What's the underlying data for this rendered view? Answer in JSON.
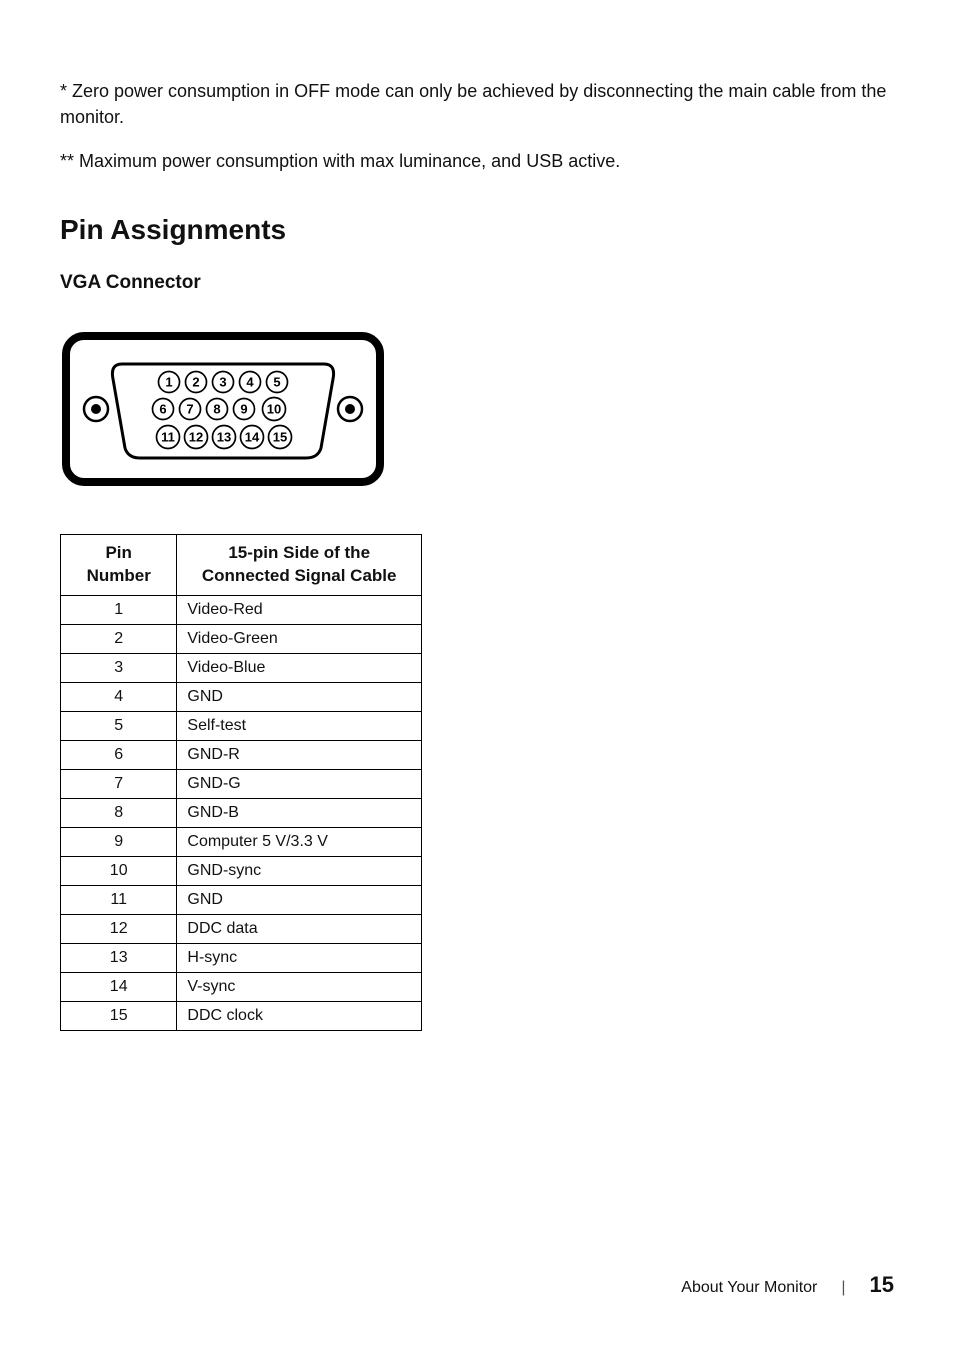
{
  "notes": {
    "note1": "* Zero power consumption in OFF mode can only be achieved by disconnecting the main cable from the monitor.",
    "note2": "** Maximum power consumption with max luminance, and USB active."
  },
  "section_title": "Pin Assignments",
  "sub_title": "VGA Connector",
  "connector_pins": [
    "1",
    "2",
    "3",
    "4",
    "5",
    "6",
    "7",
    "8",
    "9",
    "10",
    "11",
    "12",
    "13",
    "14",
    "15"
  ],
  "table": {
    "header_col1_line1": "Pin",
    "header_col1_line2": "Number",
    "header_col2_line1": "15-pin Side of the",
    "header_col2_line2": "Connected Signal Cable",
    "rows": [
      {
        "pin": "1",
        "signal": "Video-Red"
      },
      {
        "pin": "2",
        "signal": "Video-Green"
      },
      {
        "pin": "3",
        "signal": "Video-Blue"
      },
      {
        "pin": "4",
        "signal": "GND"
      },
      {
        "pin": "5",
        "signal": "Self-test"
      },
      {
        "pin": "6",
        "signal": "GND-R"
      },
      {
        "pin": "7",
        "signal": "GND-G"
      },
      {
        "pin": "8",
        "signal": "GND-B"
      },
      {
        "pin": "9",
        "signal": "Computer 5 V/3.3 V"
      },
      {
        "pin": "10",
        "signal": "GND-sync"
      },
      {
        "pin": "11",
        "signal": "GND"
      },
      {
        "pin": "12",
        "signal": "DDC data"
      },
      {
        "pin": "13",
        "signal": "H-sync"
      },
      {
        "pin": "14",
        "signal": "V-sync"
      },
      {
        "pin": "15",
        "signal": "DDC clock"
      }
    ]
  },
  "footer": {
    "text": "About Your Monitor",
    "page": "15"
  }
}
